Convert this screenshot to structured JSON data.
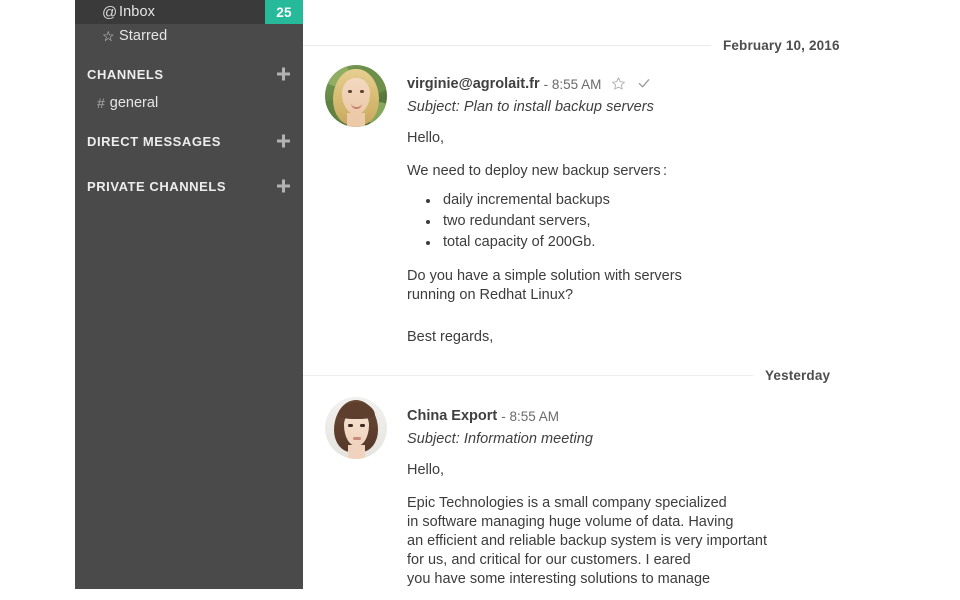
{
  "sidebar": {
    "nav": [
      {
        "icon": "at-icon",
        "glyph": "@",
        "label": "Inbox",
        "badge": "25",
        "active": true
      },
      {
        "icon": "star-outline-icon",
        "glyph": "☆",
        "label": "Starred",
        "badge": "",
        "active": false
      }
    ],
    "sections": [
      {
        "title": "CHANNELS",
        "add_icon": "plus-icon",
        "items": [
          {
            "prefix": "#",
            "label": "general"
          }
        ]
      },
      {
        "title": "DIRECT MESSAGES",
        "add_icon": "plus-icon",
        "items": []
      },
      {
        "title": "PRIVATE CHANNELS",
        "add_icon": "plus-icon",
        "items": []
      }
    ]
  },
  "conversation": {
    "groups": [
      {
        "date_label": "February 10, 2016",
        "rule_width": 408,
        "message": {
          "sender": "virginie@agrolait.fr",
          "time": "- 8:55 AM",
          "star_icon": "star-outline-icon",
          "star_glyph": "☆",
          "check_icon": "check-mark-icon",
          "check_glyph": "✔",
          "subject": "Subject: Plan to install backup servers",
          "greeting": "Hello,",
          "intro": "We need to deploy new backup servers :",
          "bullets": [
            "daily incremental backups",
            "two redundant servers,",
            "total capacity of 200Gb."
          ],
          "question": "Do you have a simple solution with servers\nrunning on Redhat Linux?",
          "closing": "Best regards,"
        }
      },
      {
        "date_label": "Yesterday",
        "rule_width": 450,
        "message": {
          "sender": "China Export",
          "time": "- 8:55 AM",
          "subject": "Subject: Information meeting",
          "greeting": "Hello,",
          "paragraph": "Epic Technologies is a small company specialized\nin software managing huge volume of data. Having\nan efficient and reliable backup system is very important\nfor us, and critical for our customers. I eared\nyou have some interesting solutions to manage"
        }
      }
    ]
  },
  "colors": {
    "sidebar_bg": "#4a4a4a",
    "sidebar_active_bg": "#3a3a3a",
    "badge_bg": "#26b99a",
    "text_body": "#3c3c3c",
    "rule": "#ececec"
  }
}
